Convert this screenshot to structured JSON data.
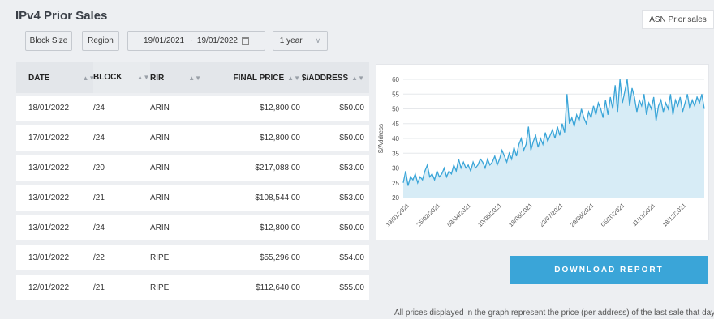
{
  "header": {
    "title": "IPv4 Prior Sales",
    "asn_button": "ASN Prior sales"
  },
  "filters": {
    "block_size": "Block Size",
    "region": "Region",
    "date_from": "19/01/2021",
    "date_sep": "~",
    "date_to": "19/01/2022",
    "period": "1 year"
  },
  "table": {
    "headers": [
      "DATE",
      "BLOCK",
      "RIR",
      "FINAL PRICE",
      "$/ADDRESS"
    ],
    "rows": [
      [
        "18/01/2022",
        "/24",
        "ARIN",
        "$12,800.00",
        "$50.00"
      ],
      [
        "17/01/2022",
        "/24",
        "ARIN",
        "$12,800.00",
        "$50.00"
      ],
      [
        "13/01/2022",
        "/20",
        "ARIN",
        "$217,088.00",
        "$53.00"
      ],
      [
        "13/01/2022",
        "/21",
        "ARIN",
        "$108,544.00",
        "$53.00"
      ],
      [
        "13/01/2022",
        "/24",
        "ARIN",
        "$12,800.00",
        "$50.00"
      ],
      [
        "13/01/2022",
        "/22",
        "RIPE",
        "$55,296.00",
        "$54.00"
      ],
      [
        "12/01/2022",
        "/21",
        "RIPE",
        "$112,640.00",
        "$55.00"
      ]
    ]
  },
  "chart_data": {
    "type": "area",
    "ylabel": "$/Address",
    "ylim": [
      20,
      60
    ],
    "yticks": [
      "20",
      "25",
      "30",
      "35",
      "40",
      "45",
      "50",
      "55",
      "60"
    ],
    "xticks": [
      "19/01/2021",
      "25/02/2021",
      "03/04/2021",
      "10/05/2021",
      "16/06/2021",
      "23/07/2021",
      "29/08/2021",
      "05/10/2021",
      "11/11/2021",
      "18/12/2021"
    ],
    "grid": true,
    "color": "#3aa5d8",
    "fill": "#d7ecf6",
    "series": [
      {
        "values": [
          25,
          29,
          24,
          27,
          26,
          28,
          25,
          27,
          26,
          29,
          31,
          27,
          28,
          26,
          29,
          27,
          28,
          30,
          27,
          29,
          28,
          31,
          29,
          33,
          30,
          32,
          30,
          31,
          29,
          32,
          30,
          31,
          33,
          32,
          30,
          33,
          31,
          32,
          34,
          31,
          33,
          36,
          34,
          32,
          35,
          33,
          37,
          34,
          38,
          40,
          36,
          38,
          44,
          36,
          39,
          41,
          37,
          40,
          38,
          42,
          39,
          41,
          43,
          40,
          44,
          41,
          45,
          42,
          55,
          45,
          47,
          44,
          48,
          46,
          50,
          47,
          45,
          49,
          47,
          51,
          48,
          52,
          50,
          47,
          53,
          48,
          54,
          50,
          58,
          49,
          60,
          52,
          56,
          60,
          51,
          57,
          54,
          49,
          53,
          51,
          55,
          48,
          52,
          50,
          54,
          46,
          51,
          53,
          49,
          52,
          50,
          55,
          48,
          53,
          51,
          54,
          49,
          52,
          55,
          50,
          53,
          51,
          54,
          52,
          55,
          50
        ]
      }
    ]
  },
  "download_label": "DOWNLOAD REPORT",
  "footnote": "All prices displayed in the graph represent the price (per address) of the last sale that day"
}
